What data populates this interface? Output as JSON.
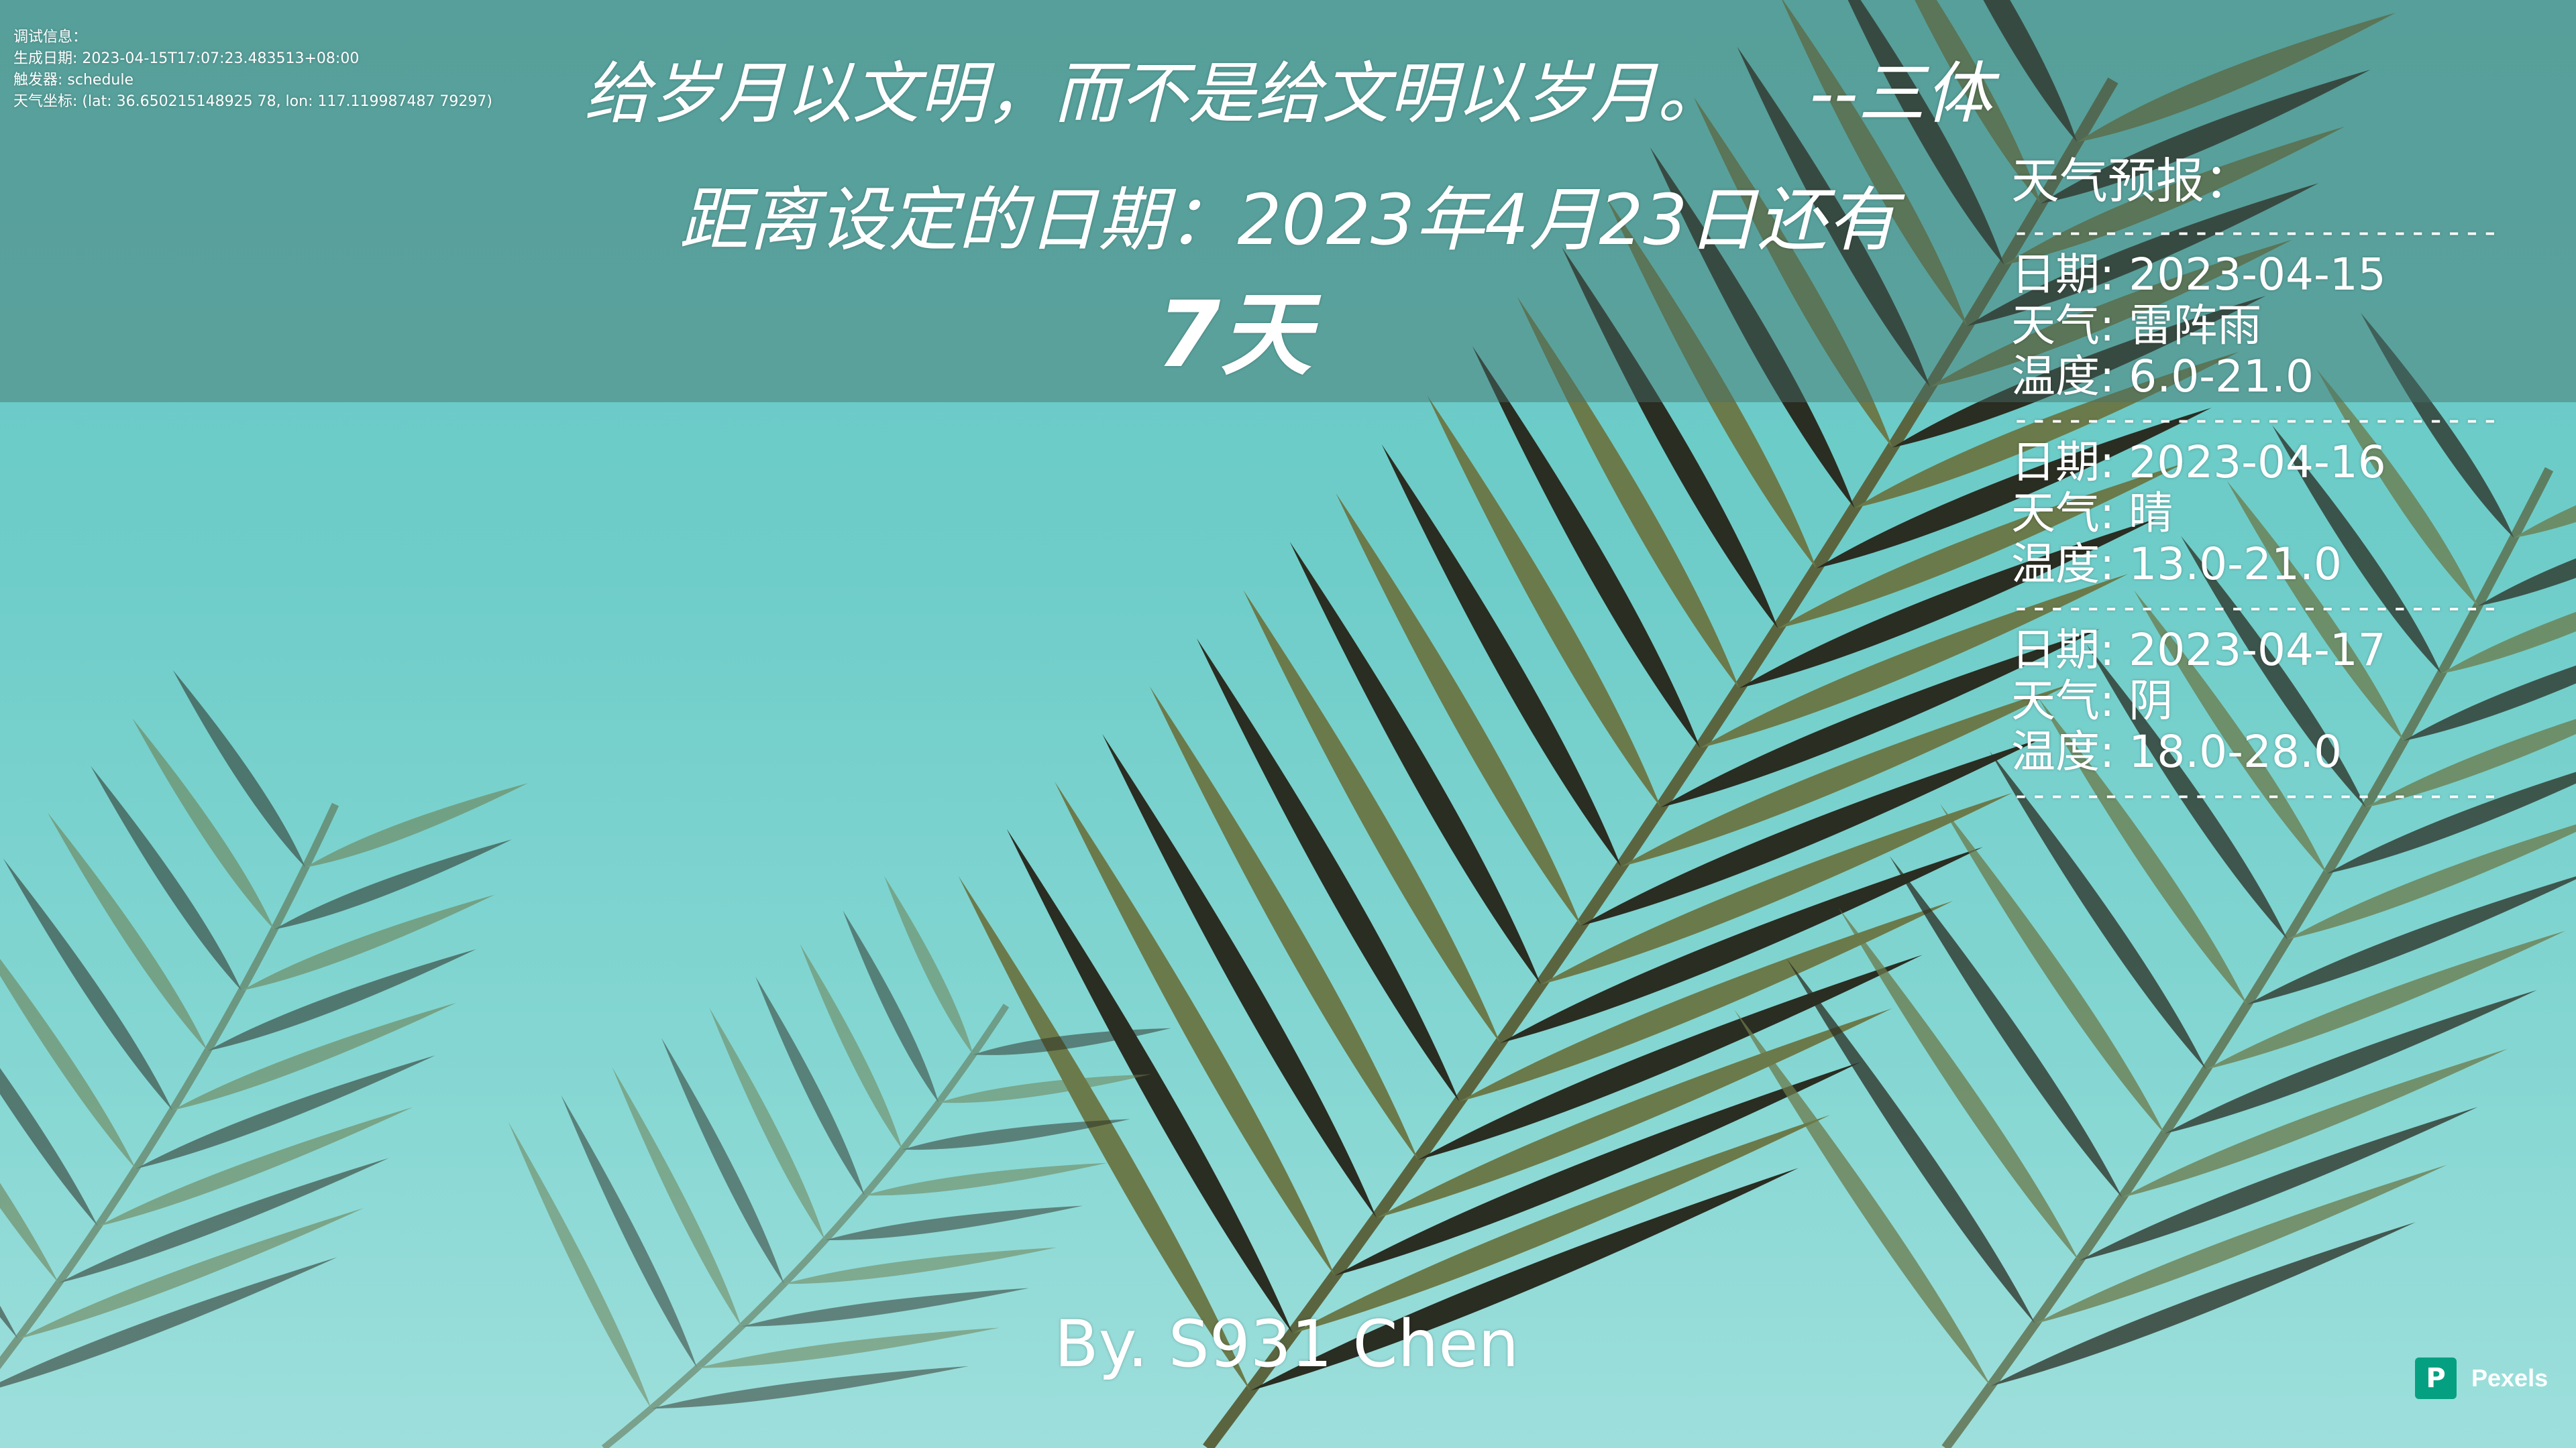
{
  "debug": {
    "heading": "调试信息：",
    "generated_label": "生成日期",
    "generated_value": "2023-04-15T17:07:23.483513+08:00",
    "trigger_label": "触发器",
    "trigger_value": "schedule",
    "coords_label": "天气坐标",
    "coords_value": "(lat: 36.650215148925 78, lon: 117.119987487 79297)"
  },
  "quote": {
    "text": "给岁月以文明，而不是给文明以岁月。",
    "source": "--三体"
  },
  "countdown": {
    "text": "距离设定的日期：2023年4月23日还有",
    "days": "7天"
  },
  "forecast": {
    "title": "天气预报：",
    "divider": "------------------------------",
    "date_label": "日期",
    "weather_label": "天气",
    "temp_label": "温度",
    "days": [
      {
        "date": "2023-04-15",
        "weather": "雷阵雨",
        "temp": "6.0-21.0"
      },
      {
        "date": "2023-04-16",
        "weather": "晴",
        "temp": "13.0-21.0"
      },
      {
        "date": "2023-04-17",
        "weather": "阴",
        "temp": "18.0-28.0"
      }
    ]
  },
  "byline": "By. S931 Chen",
  "watermark": {
    "icon": "pexels-logo-icon",
    "glyph": "P",
    "label": "Pexels",
    "color": "#05a081"
  },
  "colors": {
    "sky_top": "#63c7c4",
    "sky_bottom": "#9edfdc",
    "leaf": "#6b7a4a",
    "leaf_shadow": "#2a2d22"
  }
}
